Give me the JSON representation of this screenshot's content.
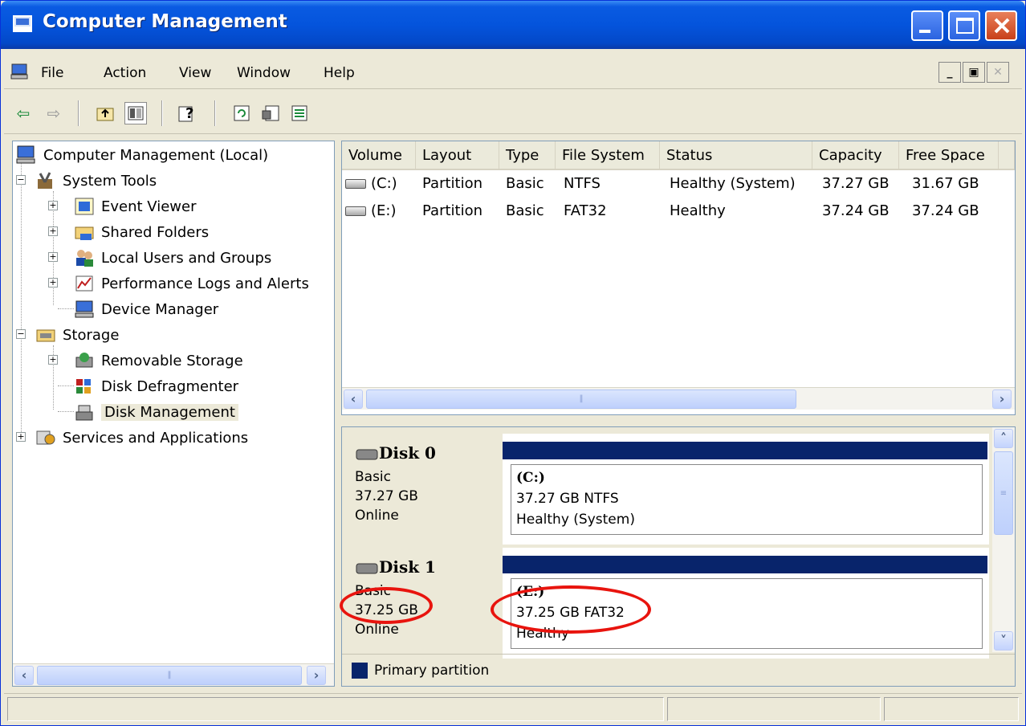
{
  "window": {
    "title": "Computer Management"
  },
  "menu": [
    "File",
    "Action",
    "View",
    "Window",
    "Help"
  ],
  "tree": {
    "root": "Computer Management (Local)",
    "system_tools": "System Tools",
    "event_viewer": "Event Viewer",
    "shared_folders": "Shared Folders",
    "local_users": "Local Users and Groups",
    "perf_logs": "Performance Logs and Alerts",
    "device_manager": "Device Manager",
    "storage": "Storage",
    "removable_storage": "Removable Storage",
    "disk_defrag": "Disk Defragmenter",
    "disk_management": "Disk Management",
    "services_apps": "Services and Applications"
  },
  "volumes": {
    "columns": [
      "Volume",
      "Layout",
      "Type",
      "File System",
      "Status",
      "Capacity",
      "Free Space"
    ],
    "rows": [
      [
        "(C:)",
        "Partition",
        "Basic",
        "NTFS",
        "Healthy (System)",
        "37.27 GB",
        "31.67 GB"
      ],
      [
        "(E:)",
        "Partition",
        "Basic",
        "FAT32",
        "Healthy",
        "37.24 GB",
        "37.24 GB"
      ]
    ]
  },
  "disks": [
    {
      "name": "Disk 0",
      "type": "Basic",
      "size": "37.27 GB",
      "state": "Online",
      "vol_letter": "(C:)",
      "vol_size": "37.27 GB NTFS",
      "vol_status": "Healthy (System)"
    },
    {
      "name": "Disk 1",
      "type": "Basic",
      "size": "37.25 GB",
      "state": "Online",
      "vol_letter": "(E:)",
      "vol_size": "37.25 GB FAT32",
      "vol_status": "Healthy"
    }
  ],
  "legend": {
    "label": "Primary partition"
  },
  "colors": {
    "primary_partition": "#08246b",
    "title_bar": "#0454dc",
    "annotation": "#e8140e"
  }
}
